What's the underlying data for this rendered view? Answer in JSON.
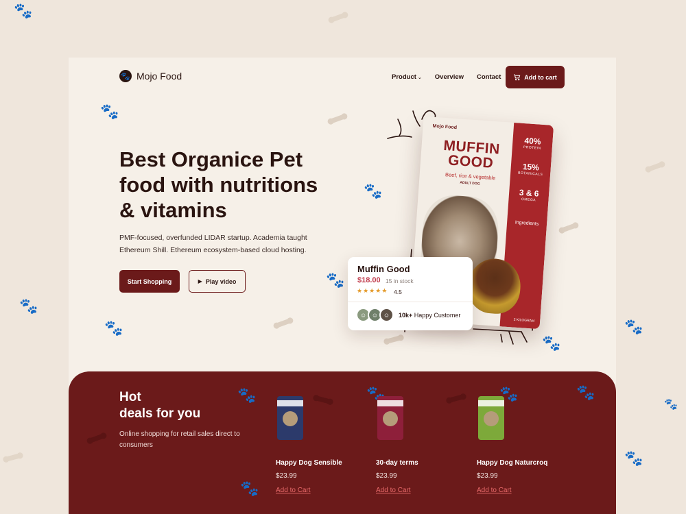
{
  "brand": {
    "name": "Mojo Food"
  },
  "nav": {
    "product": "Product",
    "overview": "Overview",
    "contact": "Contact",
    "cart": "Add to cart"
  },
  "hero": {
    "title": "Best Organice Pet food with nutritions & vitamins",
    "description": "PMF-focused, overfunded LIDAR startup. Academia taught Ethereum Shill. Ethereum ecosystem-based cloud hosting.",
    "primary_cta": "Start Shopping",
    "secondary_cta": "Play video"
  },
  "bag": {
    "brand": "Mojo Food",
    "title": "MUFFIN GOOD",
    "subtitle": "Beef, rice & vegetable",
    "label": "ADULT DOG",
    "stats": [
      {
        "value": "40%",
        "label": "PROTEIN"
      },
      {
        "value": "15%",
        "label": "BOTANICALS"
      },
      {
        "value": "3 & 6",
        "label": "OMEGA"
      }
    ],
    "ingredients": "Ingredients",
    "weight": "2 KILOGRAM"
  },
  "product_card": {
    "name": "Muffin Good",
    "price": "$18.00",
    "stock": "15 in stock",
    "stars": 5,
    "rating": "4.5",
    "customers_count": "10k+",
    "customers_label": "Happy Customer"
  },
  "deals": {
    "title_line1": "Hot",
    "title_line2": "deals for you",
    "description": "Online shopping for retail sales direct to consumers",
    "items": [
      {
        "name": "Happy Dog Sensible",
        "price": "$23.99",
        "link": "Add to Cart",
        "pack_color": "#2c3a6b"
      },
      {
        "name": "30-day terms",
        "price": "$23.99",
        "link": "Add to Cart",
        "pack_color": "#8e1f3a"
      },
      {
        "name": "Happy Dog Naturcroq",
        "price": "$23.99",
        "link": "Add to Cart",
        "pack_color": "#7da93a"
      }
    ]
  },
  "colors": {
    "brand": "#6b1a1a",
    "background": "#f6f0e8",
    "price": "#c0394a",
    "star": "#e49a2a"
  }
}
